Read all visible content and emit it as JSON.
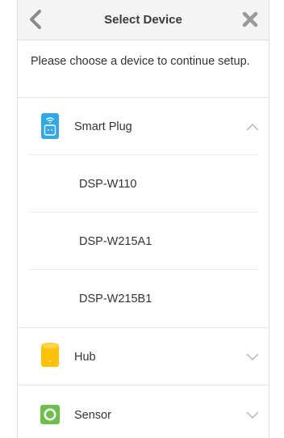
{
  "header": {
    "title": "Select Device",
    "back_icon": "chevron-left-icon",
    "close_icon": "close-icon"
  },
  "intro_text": "Please choose a device to continue setup.",
  "categories": [
    {
      "label": "Smart Plug",
      "icon": "smart-plug-icon",
      "expanded": true,
      "devices": [
        "DSP-W110",
        "DSP-W215A1",
        "DSP-W215B1"
      ]
    },
    {
      "label": "Hub",
      "icon": "hub-icon",
      "expanded": false
    },
    {
      "label": "Sensor",
      "icon": "sensor-icon",
      "expanded": false
    }
  ],
  "colors": {
    "header_bg": "#f4f4f4",
    "accent_blue": "#31a8e8",
    "hub_yellow": "#ffc107",
    "sensor_green": "#6cc04a",
    "icon_grey": "#8a8a8a"
  }
}
